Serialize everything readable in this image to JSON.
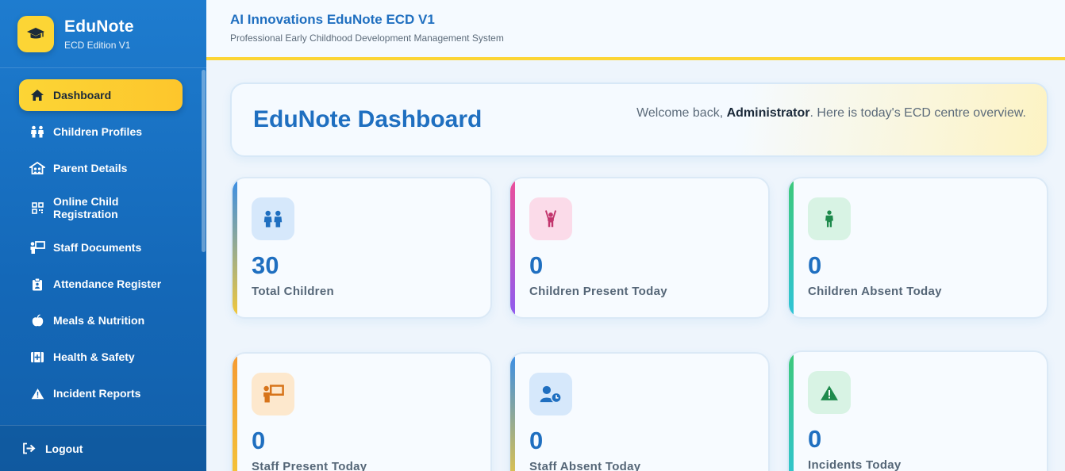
{
  "brand": {
    "name": "EduNote",
    "subtitle": "ECD Edition V1"
  },
  "nav": [
    {
      "label": "Dashboard",
      "icon": "home-icon",
      "active": true
    },
    {
      "label": "Children Profiles",
      "icon": "children-icon"
    },
    {
      "label": "Parent Details",
      "icon": "parents-icon"
    },
    {
      "label": "Online Child Registration",
      "icon": "qrcode-icon"
    },
    {
      "label": "Staff Documents",
      "icon": "teacher-icon"
    },
    {
      "label": "Attendance Register",
      "icon": "clipboard-icon"
    },
    {
      "label": "Meals & Nutrition",
      "icon": "apple-icon"
    },
    {
      "label": "Health & Safety",
      "icon": "first-aid-icon"
    },
    {
      "label": "Incident Reports",
      "icon": "warning-icon"
    }
  ],
  "logout_label": "Logout",
  "header": {
    "title": "AI Innovations EduNote ECD V1",
    "subtitle": "Professional Early Childhood Development Management System"
  },
  "welcome": {
    "title": "EduNote Dashboard",
    "greeting_prefix": "Welcome back, ",
    "user": "Administrator",
    "greeting_suffix": ". Here is today's ECD centre overview."
  },
  "stats": [
    {
      "value": "30",
      "label": "Total Children",
      "icon": "children-icon",
      "color": "#1f6fc0"
    },
    {
      "value": "0",
      "label": "Children Present Today",
      "icon": "child-raised-hands-icon",
      "color": "#c2356d"
    },
    {
      "value": "0",
      "label": "Children Absent Today",
      "icon": "child-icon",
      "color": "#1e8a4c"
    },
    {
      "value": "0",
      "label": "Staff Present Today",
      "icon": "teacher-icon",
      "color": "#d7741a"
    },
    {
      "value": "0",
      "label": "Staff Absent Today",
      "icon": "user-clock-icon",
      "color": "#1f6fc0"
    },
    {
      "value": "0",
      "label": "Incidents Today",
      "icon": "warning-icon",
      "color": "#1e8a4c"
    }
  ],
  "colors": {
    "sidebar": "#1468b8",
    "accent_yellow": "#fcd535",
    "primary_blue": "#1f6fc0"
  }
}
